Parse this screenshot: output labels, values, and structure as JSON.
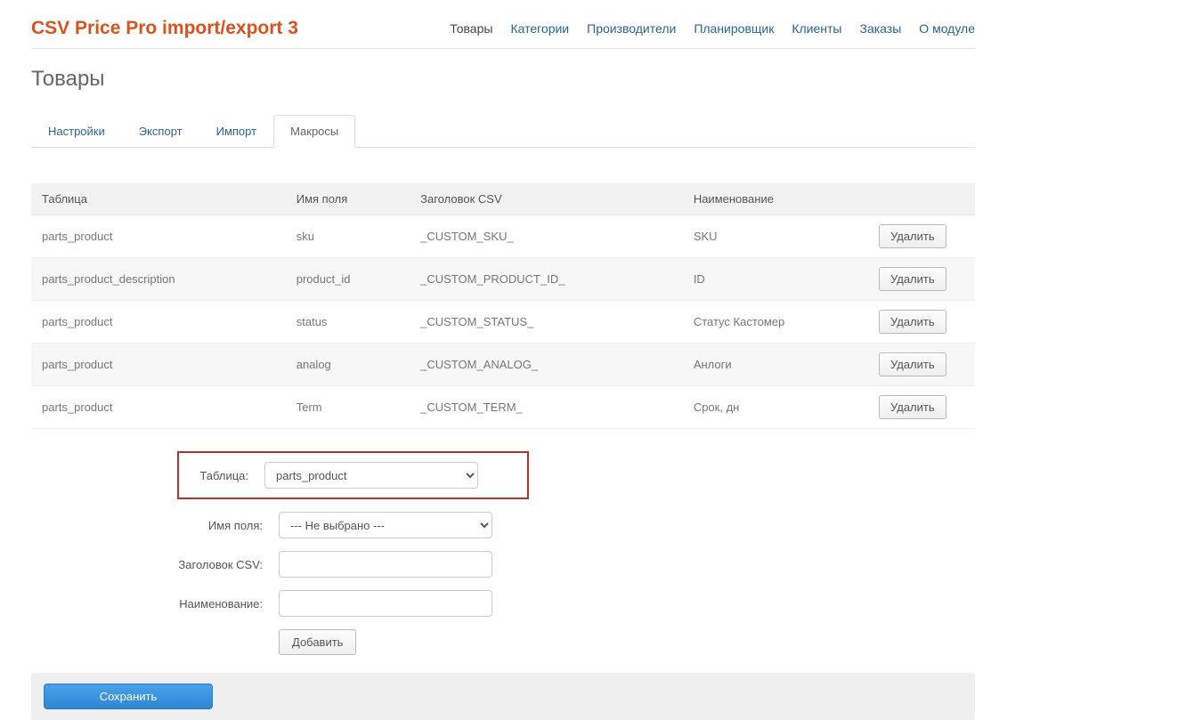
{
  "brand": "CSV Price Pro import/export 3",
  "nav": [
    {
      "label": "Товары",
      "active": true
    },
    {
      "label": "Категории"
    },
    {
      "label": "Производители"
    },
    {
      "label": "Планировщик"
    },
    {
      "label": "Клиенты"
    },
    {
      "label": "Заказы"
    },
    {
      "label": "О модуле"
    }
  ],
  "page_title": "Товары",
  "tabs": [
    {
      "label": "Настройки"
    },
    {
      "label": "Экспорт"
    },
    {
      "label": "Импорт"
    },
    {
      "label": "Макросы",
      "active": true
    }
  ],
  "table": {
    "headers": {
      "table": "Таблица",
      "field": "Имя поля",
      "csv": "Заголовок CSV",
      "name": "Наименование",
      "actions": ""
    },
    "delete_label": "Удалить",
    "rows": [
      {
        "table": "parts_product",
        "field": "sku",
        "csv": "_CUSTOM_SKU_",
        "name": "SKU"
      },
      {
        "table": "parts_product_description",
        "field": "product_id",
        "csv": "_CUSTOM_PRODUCT_ID_",
        "name": "ID"
      },
      {
        "table": "parts_product",
        "field": "status",
        "csv": "_CUSTOM_STATUS_",
        "name": "Статус Кастомер"
      },
      {
        "table": "parts_product",
        "field": "analog",
        "csv": "_CUSTOM_ANALOG_",
        "name": "Анлоги"
      },
      {
        "table": "parts_product",
        "field": "Term",
        "csv": "_CUSTOM_TERM_",
        "name": "Срок, дн"
      }
    ]
  },
  "form": {
    "table_label": "Таблица:",
    "table_value": "parts_product",
    "field_label": "Имя поля:",
    "field_value": "--- Не выбрано ---",
    "csv_label": "Заголовок CSV:",
    "csv_value": "",
    "name_label": "Наименование:",
    "name_value": "",
    "add_label": "Добавить"
  },
  "save_label": "Сохранить"
}
